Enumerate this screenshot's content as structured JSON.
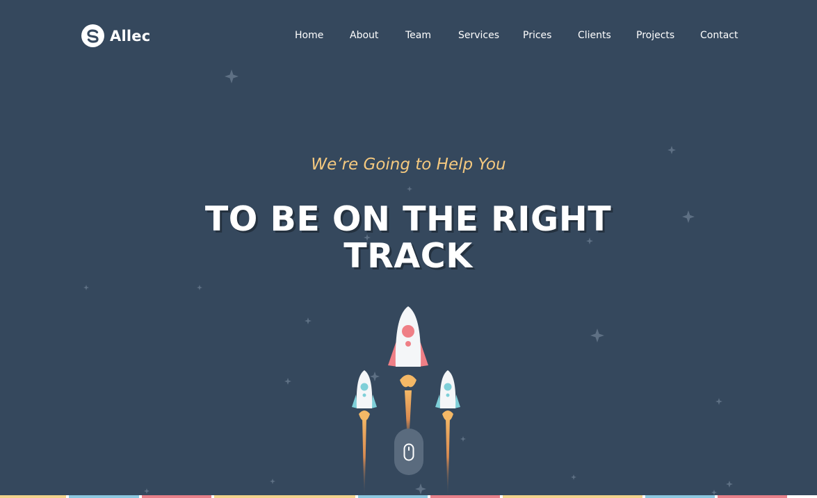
{
  "brand": {
    "name": "Allec",
    "logo_icon": "s-circle-logo-icon"
  },
  "nav": {
    "items": [
      {
        "label": "Home"
      },
      {
        "label": "About"
      },
      {
        "label": "Team"
      },
      {
        "label": "Services"
      },
      {
        "label": "Prices"
      },
      {
        "label": "Clients"
      },
      {
        "label": "Projects"
      },
      {
        "label": "Contact"
      }
    ]
  },
  "hero": {
    "tagline": "We’re Going to Help You",
    "headline_line1": "TO BE ON THE RIGHT",
    "headline_line2": "TRACK",
    "scroll_icon": "mouse-scroll-icon"
  },
  "colors": {
    "background": "#35485d",
    "tagline": "#f5c97f",
    "headline": "#ffffff",
    "star": "#5e7084",
    "rocket_body": "#f4f6f8",
    "rocket_accent_main": "#ef7f86",
    "rocket_accent_side": "#7ecfd8",
    "flame": "#f4b866",
    "scroll_button": "#5a6b7e",
    "strip": [
      "#f1d38c",
      "#8cc8e0",
      "#e8808a",
      "#f1d38c",
      "#8cc8e0",
      "#e8808a",
      "#f1d38c",
      "#8cc8e0",
      "#e8808a",
      "#f1d38c"
    ]
  }
}
